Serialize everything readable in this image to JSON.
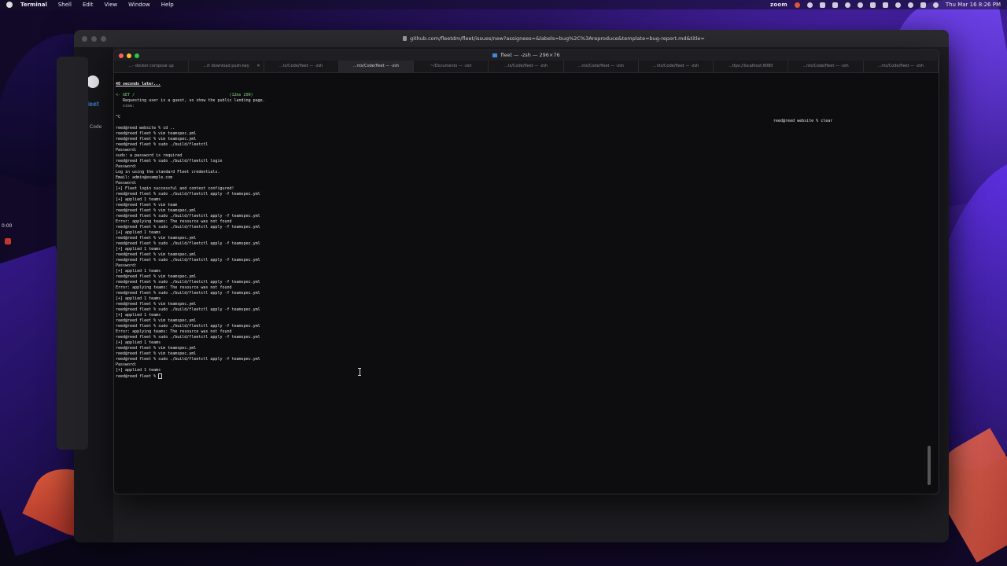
{
  "menubar": {
    "app": "Terminal",
    "items": [
      "Shell",
      "Edit",
      "View",
      "Window",
      "Help"
    ],
    "zoom": "zoom",
    "datetime": "Thu Mar 16  8:26 PM"
  },
  "browser": {
    "url": "github.com/fleetdm/fleet/issues/new?assignees=&labels=bug%2C%3Areproduce&template=bug-report.md&title=",
    "repo_label": "fleet",
    "code_label": "Code"
  },
  "recorder": {
    "time": "0:00"
  },
  "terminal": {
    "title": "fleet — -zsh — 296×76",
    "tabs": [
      "...- docker compose up",
      "...rt download push.key",
      "...ts/Code/fleet — -zsh",
      "...nts/Code/fleet — -zsh",
      "~/Documents — -zsh",
      "...ts/Code/fleet — -zsh",
      "...nts/Code/fleet — -zsh",
      "...nts/Code/fleet — -zsh",
      "...ttps://localhost:8080",
      "...nts/Code/fleet — -zsh",
      "...nts/Code/fleet — -zsh"
    ],
    "right_prompt": "reed@reed website % clear",
    "lines": [
      {
        "t": "40 seconds later...",
        "c": "bold"
      },
      {
        "t": "",
        "c": ""
      },
      {
        "t": "<- GET /                                        (12ms 200)",
        "c": "green"
      },
      {
        "t": "   Requesting user is a guest, so show the public landing page.",
        "c": ""
      },
      {
        "t": "   view:",
        "c": "dim"
      },
      {
        "t": "",
        "c": ""
      },
      {
        "t": "^C",
        "c": ""
      },
      {
        "t": "",
        "c": ""
      },
      {
        "t": "reed@reed website % cd ..",
        "c": ""
      },
      {
        "t": "reed@reed fleet % vim teamspec.yml",
        "c": ""
      },
      {
        "t": "reed@reed fleet % vim teamspec.yml",
        "c": ""
      },
      {
        "t": "reed@reed fleet % sudo ./build/fleetctl",
        "c": ""
      },
      {
        "t": "Password:",
        "c": ""
      },
      {
        "t": "sudo: a password is required",
        "c": ""
      },
      {
        "t": "reed@reed fleet % sudo ./build/fleetctl login",
        "c": ""
      },
      {
        "t": "Password:",
        "c": ""
      },
      {
        "t": "Log in using the standard Fleet credentials.",
        "c": ""
      },
      {
        "t": "Email: admin@example.com",
        "c": ""
      },
      {
        "t": "Password:",
        "c": ""
      },
      {
        "t": "[+] Fleet login successful and context configured!",
        "c": ""
      },
      {
        "t": "reed@reed fleet % sudo ./build/fleetctl apply -f teamspec.yml",
        "c": ""
      },
      {
        "t": "[+] applied 1 teams",
        "c": ""
      },
      {
        "t": "reed@reed fleet % vim team",
        "c": ""
      },
      {
        "t": "reed@reed fleet % vim teamspec.yml",
        "c": ""
      },
      {
        "t": "reed@reed fleet % sudo ./build/fleetctl apply -f teamspec.yml",
        "c": ""
      },
      {
        "t": "Error: applying teams: The resource was not found",
        "c": ""
      },
      {
        "t": "reed@reed fleet % sudo ./build/fleetctl apply -f teamspec.yml",
        "c": ""
      },
      {
        "t": "[+] applied 1 teams",
        "c": ""
      },
      {
        "t": "reed@reed fleet % vim teamspec.yml",
        "c": ""
      },
      {
        "t": "reed@reed fleet % sudo ./build/fleetctl apply -f teamspec.yml",
        "c": ""
      },
      {
        "t": "[+] applied 1 teams",
        "c": ""
      },
      {
        "t": "reed@reed fleet % vim teamspec.yml",
        "c": ""
      },
      {
        "t": "reed@reed fleet % sudo ./build/fleetctl apply -f teamspec.yml",
        "c": ""
      },
      {
        "t": "Password:",
        "c": ""
      },
      {
        "t": "[+] applied 1 teams",
        "c": ""
      },
      {
        "t": "reed@reed fleet % vim teamspec.yml",
        "c": ""
      },
      {
        "t": "reed@reed fleet % sudo ./build/fleetctl apply -f teamspec.yml",
        "c": ""
      },
      {
        "t": "Error: applying teams: The resource was not found",
        "c": ""
      },
      {
        "t": "reed@reed fleet % sudo ./build/fleetctl apply -f teamspec.yml",
        "c": ""
      },
      {
        "t": "[+] applied 1 teams",
        "c": ""
      },
      {
        "t": "reed@reed fleet % vim teamspec.yml",
        "c": ""
      },
      {
        "t": "reed@reed fleet % sudo ./build/fleetctl apply -f teamspec.yml",
        "c": ""
      },
      {
        "t": "[+] applied 1 teams",
        "c": ""
      },
      {
        "t": "reed@reed fleet % vim teamspec.yml",
        "c": ""
      },
      {
        "t": "reed@reed fleet % sudo ./build/fleetctl apply -f teamspec.yml",
        "c": ""
      },
      {
        "t": "Error: applying teams: The resource was not found",
        "c": ""
      },
      {
        "t": "reed@reed fleet % sudo ./build/fleetctl apply -f teamspec.yml",
        "c": ""
      },
      {
        "t": "[+] applied 1 teams",
        "c": ""
      },
      {
        "t": "reed@reed fleet % vim teamspec.yml",
        "c": ""
      },
      {
        "t": "reed@reed fleet % vim teamspec.yml",
        "c": ""
      },
      {
        "t": "reed@reed fleet % sudo ./build/fleetctl apply -f teamspec.yml",
        "c": ""
      },
      {
        "t": "Password:",
        "c": ""
      },
      {
        "t": "[+] applied 1 teams",
        "c": ""
      },
      {
        "t": "reed@reed fleet % ",
        "c": "prompt"
      }
    ]
  },
  "colors": {
    "terminal_bg": "#0d0d0f",
    "accent_green": "#7fd67f",
    "link_blue": "#4aa3ff"
  }
}
